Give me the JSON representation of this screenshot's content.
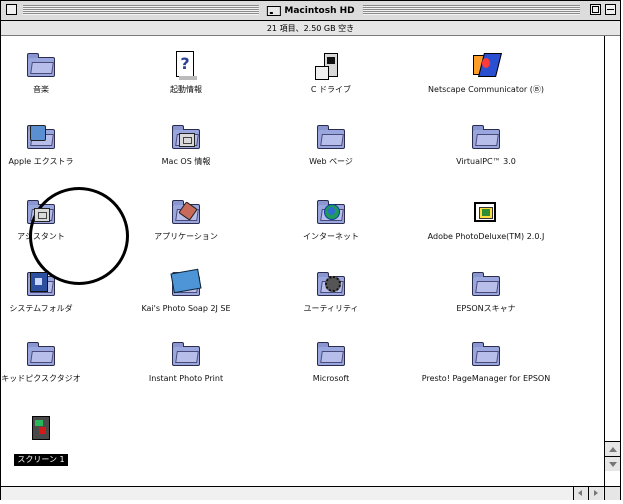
{
  "window": {
    "title": "Macintosh HD",
    "info": "21 項目、2.50 GB 空き"
  },
  "items": [
    {
      "label": "音楽",
      "icon": "folder-icon",
      "badge": ""
    },
    {
      "label": "起動情報",
      "icon": "help-document-icon",
      "badge": ""
    },
    {
      "label": "C ドライブ",
      "icon": "drive-icon",
      "badge": ""
    },
    {
      "label": "Netscape Communicator (Ⓑ)",
      "icon": "netscape-icon",
      "badge": ""
    },
    {
      "label": "Apple エクストラ",
      "icon": "folder-icon",
      "badge": "tools"
    },
    {
      "label": "Mac OS 情報",
      "icon": "folder-icon",
      "badge": "window"
    },
    {
      "label": "Web ページ",
      "icon": "folder-icon",
      "badge": ""
    },
    {
      "label": "VirtualPC™ 3.0",
      "icon": "folder-icon",
      "badge": ""
    },
    {
      "label": "アシスタント",
      "icon": "folder-icon",
      "badge": "window"
    },
    {
      "label": "アプリケーション",
      "icon": "folder-icon",
      "badge": "brush"
    },
    {
      "label": "インターネット",
      "icon": "folder-icon",
      "badge": "globe"
    },
    {
      "label": "Adobe PhotoDeluxe(TM) 2.0.J",
      "icon": "photo-deluxe-icon",
      "badge": ""
    },
    {
      "label": "システムフォルダ",
      "icon": "folder-icon",
      "badge": "puzzle"
    },
    {
      "label": "Kai's Photo Soap 2J SE",
      "icon": "folder-icon",
      "badge": "map"
    },
    {
      "label": "ユーティリティ",
      "icon": "folder-icon",
      "badge": "gear"
    },
    {
      "label": "EPSONスキャナ",
      "icon": "folder-icon",
      "badge": ""
    },
    {
      "label": "キッドピクスクタジオ",
      "icon": "folder-icon",
      "badge": ""
    },
    {
      "label": "Instant Photo Print",
      "icon": "folder-icon",
      "badge": ""
    },
    {
      "label": "Microsoft",
      "icon": "folder-icon",
      "badge": ""
    },
    {
      "label": "Presto! PageManager for EPSON",
      "icon": "folder-icon",
      "badge": ""
    },
    {
      "label": "スクリーン 1",
      "icon": "screenshot-file-icon",
      "badge": "",
      "selected": true
    }
  ]
}
